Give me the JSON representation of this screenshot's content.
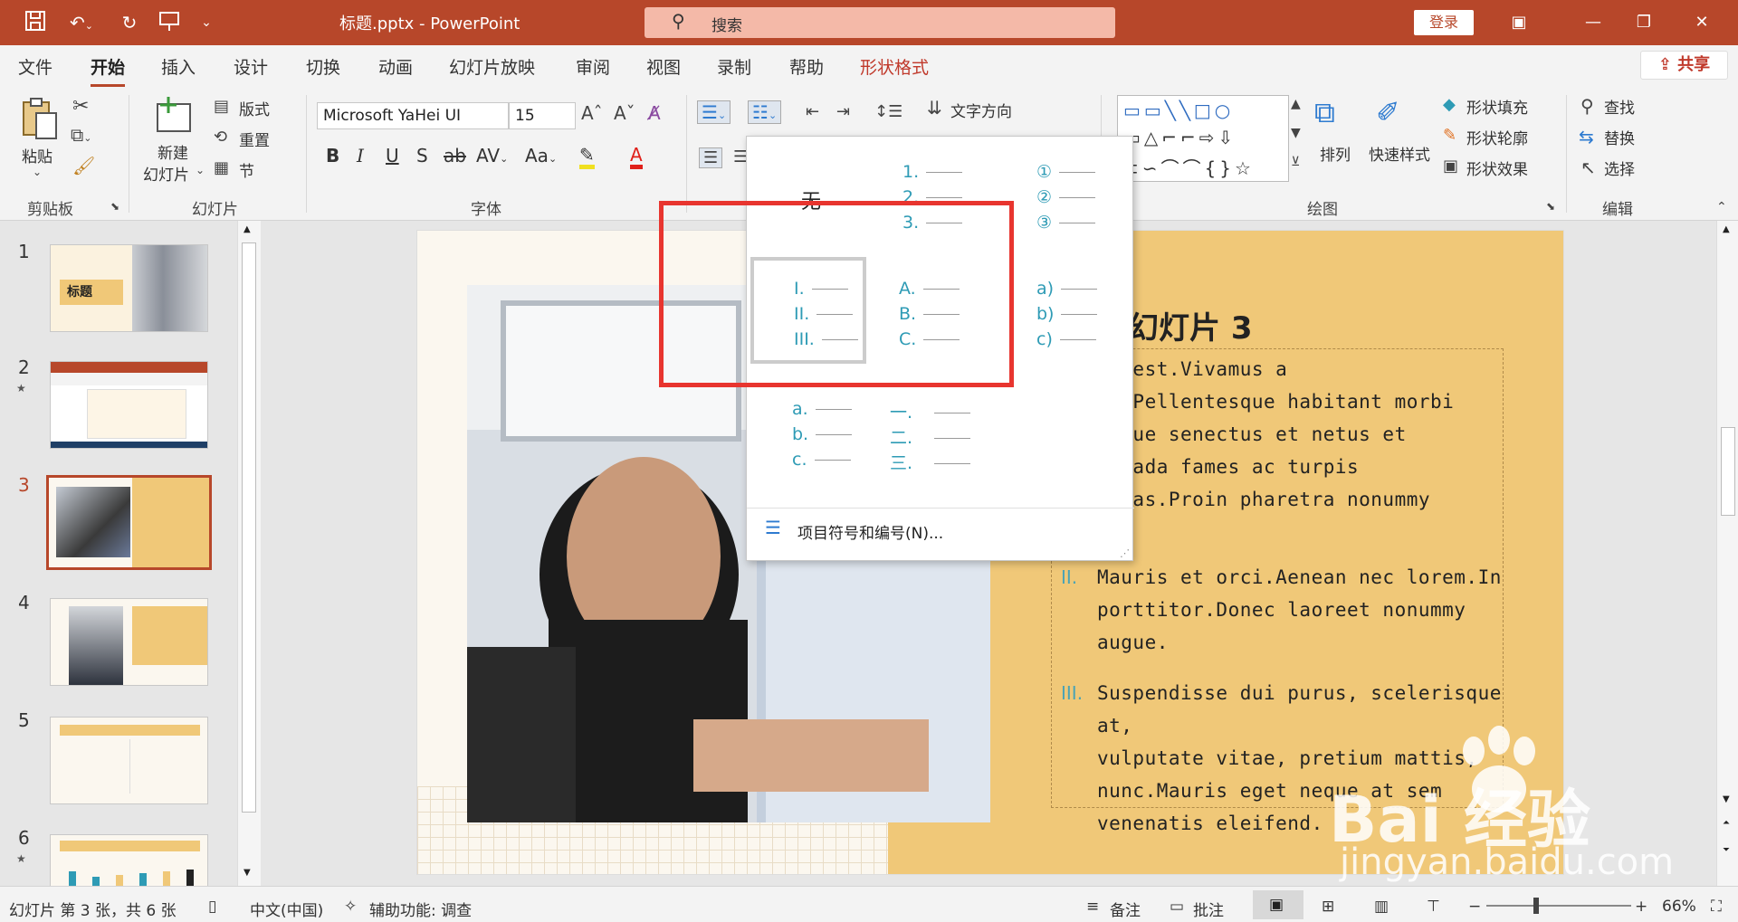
{
  "window": {
    "doc_title": "标题.pptx  -  PowerPoint",
    "search_placeholder": "搜索",
    "login_label": "登录"
  },
  "tabs": [
    "文件",
    "开始",
    "插入",
    "设计",
    "切换",
    "动画",
    "幻灯片放映",
    "审阅",
    "视图",
    "录制",
    "帮助",
    "形状格式"
  ],
  "share_label": "共享",
  "ribbon": {
    "clipboard": {
      "paste": "粘贴",
      "label": "剪贴板"
    },
    "slides": {
      "new_slide_1": "新建",
      "new_slide_2": "幻灯片",
      "layout": "版式",
      "reset": "重置",
      "section": "节",
      "label": "幻灯片"
    },
    "font": {
      "name": "Microsoft YaHei UI",
      "size": "15",
      "label": "字体"
    },
    "paragraph": {
      "text_direction": "文字方向"
    },
    "drawing": {
      "arrange": "排列",
      "quick_styles": "快速样式",
      "fill": "形状填充",
      "outline": "形状轮廓",
      "effects": "形状效果",
      "label": "绘图"
    },
    "editing": {
      "find": "查找",
      "replace": "替换",
      "select": "选择",
      "label": "编辑"
    }
  },
  "thumbs": [
    {
      "num": "1",
      "title": "标题"
    },
    {
      "num": "2",
      "title": ""
    },
    {
      "num": "3",
      "title": ""
    },
    {
      "num": "4",
      "title": ""
    },
    {
      "num": "5",
      "title": ""
    },
    {
      "num": "6",
      "title": ""
    }
  ],
  "slide": {
    "title": "幻灯片 3",
    "paragraphs": [
      {
        "num": "",
        "lines": [
          "ce est.Vivamus a",
          "us.Pellentesque habitant morbi",
          "tique senectus et netus et",
          "esuada fames ac turpis",
          "estas.Proin pharetra nonummy",
          "le."
        ]
      },
      {
        "num": "II.",
        "lines": [
          "Mauris et orci.Aenean nec lorem.In",
          "porttitor.Donec laoreet nonummy",
          "augue."
        ]
      },
      {
        "num": "III.",
        "lines": [
          "Suspendisse dui purus, scelerisque at,",
          "vulputate vitae, pretium mattis,",
          "nunc.Mauris eget neque at sem",
          "venenatis eleifend."
        ]
      }
    ]
  },
  "numbering_dropdown": {
    "none_label": "无",
    "options": [
      [
        "1.",
        "2.",
        "3."
      ],
      [
        "①",
        "②",
        "③"
      ],
      [
        "I.",
        "II.",
        "III."
      ],
      [
        "A.",
        "B.",
        "C."
      ],
      [
        "a)",
        "b)",
        "c)"
      ],
      [
        "a.",
        "b.",
        "c."
      ],
      [
        "一.",
        "二.",
        "三."
      ]
    ],
    "more_label": "项目符号和编号(N)..."
  },
  "status": {
    "slide_info": "幻灯片 第 3 张，共 6 张",
    "language": "中文(中国)",
    "accessibility": "辅助功能: 调查",
    "notes": "备注",
    "comments": "批注",
    "zoom": "66%"
  },
  "watermark": {
    "brand": "Bai  经验",
    "url": "jingyan.baidu.com"
  },
  "colors": {
    "accent": "#b7472a",
    "slide_panel": "#f0c878",
    "numbering": "#2e9bb5",
    "highlight_box": "#e8352f"
  }
}
